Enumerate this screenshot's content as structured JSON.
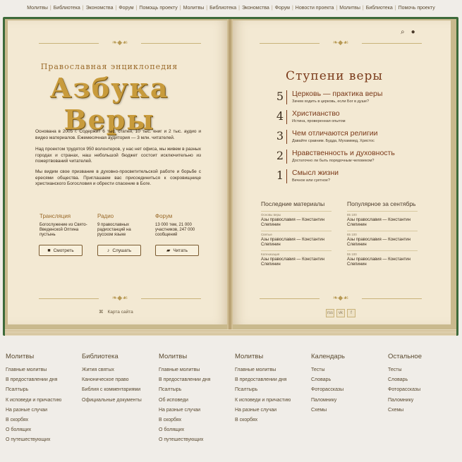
{
  "topnav": [
    "Молитвы",
    "Библиотека",
    "Экономства",
    "Форум",
    "Помощь проекту",
    "Молитвы",
    "Библиотека",
    "Экономства",
    "Форум",
    "Новости проекта",
    "Молитвы",
    "Библиотека",
    "Помочь проекту"
  ],
  "left": {
    "subtitle": "Православная энциклопедия",
    "title": "Азбука Веры",
    "p1": "Основана в 2005 г. Содержит 6 тыс. статей, 10 тыс. книг и 2 тыс. аудио и видео материалов. Ежемесячная аудитория — 3 млн. читателей.",
    "p2": "Над проектом трудятся 950 волонтеров, у нас нет офиса, мы живем в разных городах и странах, наш небольшой бюджет состоит исключительно из пожертвований читателей.",
    "p3": "Мы видим свое призвание в духовно-просветительской работе и борьбе с ересями общества. Приглашаем вас присоединиться к сокровищнице христианского Богословия и обрести спасение в Боге.",
    "columns": [
      {
        "title": "Трансляция",
        "text": "Богослужение из Свято-Введенской Оптина пустынь",
        "button": "Смотреть"
      },
      {
        "title": "Радио",
        "text": "9 православных радиостанций на русском языке",
        "button": "Слушать"
      },
      {
        "title": "Форум",
        "text": "13 000 тем, 21 000 участников, 247 000 сообщений",
        "button": "Читать"
      }
    ],
    "sitemap": "Карта сайта"
  },
  "right": {
    "steps_title": "Ступени веры",
    "steps": [
      {
        "num": "5",
        "title": "Церковь — практика веры",
        "sub": "Зачем ходить в церковь, если Бог в душе?"
      },
      {
        "num": "4",
        "title": "Христианство",
        "sub": "Истина, проверенная опытом"
      },
      {
        "num": "3",
        "title": "Чем отличаются религии",
        "sub": "Давайте сравним. Будда, Мухаммед, Христос"
      },
      {
        "num": "2",
        "title": "Нравственность и духовность",
        "sub": "Достаточно ли быть порядочным человеком?"
      },
      {
        "num": "1",
        "title": "Смысл жизни",
        "sub": "Вечное или суетное?"
      }
    ],
    "latest_title": "Последние материалы",
    "latest": [
      {
        "cat": "Основы веры",
        "text": "Азы православия — Константин Слепинин"
      },
      {
        "cat": "Святые",
        "text": "Азы православия — Константин Слепинин"
      },
      {
        "cat": "Катехизация",
        "text": "Азы православия — Константин Слепинин"
      }
    ],
    "popular_title": "Популярное за сентябрь",
    "popular": [
      {
        "cat": "85 100",
        "text": "Азы православия — Константин Слепинин"
      },
      {
        "cat": "65 100",
        "text": "Азы православия — Константин Слепинин"
      },
      {
        "cat": "55 100",
        "text": "Азы православия — Константин Слепинин"
      }
    ],
    "social": [
      "rss",
      "vk",
      "f"
    ]
  },
  "footer": [
    {
      "title": "Молитвы",
      "links": [
        "Главные молитвы",
        "В предоставлении дня",
        "Псалтырь",
        "К исповеди и причастию",
        "На разные случаи",
        "В скорбях",
        "О болящих",
        "О путешествующих"
      ]
    },
    {
      "title": "Библиотека",
      "links": [
        "Жития святых",
        "Каноническое право",
        "Библия с комментариями",
        "Официальные документы"
      ]
    },
    {
      "title": "Молитвы",
      "links": [
        "Главные молитвы",
        "В предоставлении дня",
        "Псалтырь",
        "Об исповеди",
        "На разные случаи",
        "В скорбях",
        "О болящих",
        "О путешествующих"
      ]
    },
    {
      "title": "Молитвы",
      "links": [
        "Главные молитвы",
        "В предоставлении дня",
        "Псалтырь",
        "К исповеди и причастию",
        "На разные случаи",
        "В скорбях"
      ]
    },
    {
      "title": "Календарь",
      "links": [
        "Тесты",
        "Словарь",
        "Фоторассказы",
        "Паломнику",
        "Схемы"
      ]
    },
    {
      "title": "Остальное",
      "links": [
        "Тесты",
        "Словарь",
        "Фоторассказы",
        "Паломнику",
        "Схемы"
      ]
    }
  ]
}
